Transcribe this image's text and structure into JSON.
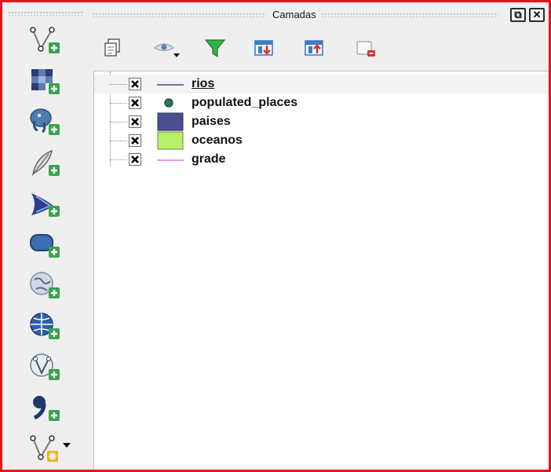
{
  "panel": {
    "title": "Camadas"
  },
  "window_buttons": {
    "float_label": "⧉",
    "close_label": "✕"
  },
  "left_toolbar": [
    {
      "name": "add-vector-layer-icon"
    },
    {
      "name": "add-raster-layer-icon"
    },
    {
      "name": "add-postgis-layer-icon"
    },
    {
      "name": "add-spatialite-layer-icon"
    },
    {
      "name": "add-mssql-layer-icon"
    },
    {
      "name": "add-oracle-layer-icon"
    },
    {
      "name": "add-wms-layer-icon"
    },
    {
      "name": "add-wcs-layer-icon"
    },
    {
      "name": "add-wfs-layer-icon"
    },
    {
      "name": "add-delimited-text-layer-icon"
    },
    {
      "name": "new-shapefile-layer-icon"
    }
  ],
  "layer_toolbar": [
    {
      "name": "add-group-icon"
    },
    {
      "name": "visibility-menu-icon"
    },
    {
      "name": "filter-legend-icon"
    },
    {
      "name": "expand-all-icon"
    },
    {
      "name": "collapse-all-icon"
    },
    {
      "name": "remove-layer-icon"
    }
  ],
  "layers": [
    {
      "name": "rios",
      "symbol": "line",
      "color": "#3b4a9a",
      "checked": true,
      "selected": true
    },
    {
      "name": "populated_places",
      "symbol": "point",
      "color": "#2f7a55",
      "checked": true,
      "selected": false
    },
    {
      "name": "paises",
      "symbol": "fill",
      "color": "#4b4f8f",
      "checked": true,
      "selected": false
    },
    {
      "name": "oceanos",
      "symbol": "fill",
      "color": "#b9f06a",
      "checked": true,
      "selected": false
    },
    {
      "name": "grade",
      "symbol": "line",
      "color": "#e07ad0",
      "checked": true,
      "selected": false
    }
  ]
}
